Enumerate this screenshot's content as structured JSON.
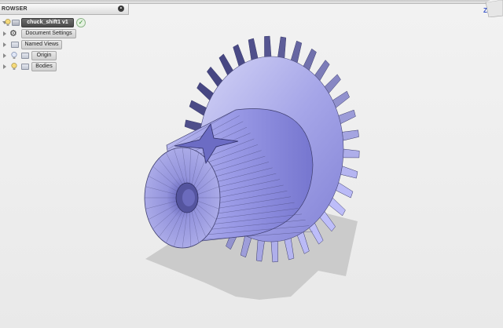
{
  "browser": {
    "header": "ROWSER",
    "collapse_icon": "minus-circle-icon",
    "items": [
      {
        "label": "chuck_shift1 v1",
        "icon": "lightbulb-icon",
        "status_icon": "check-icon",
        "style": "dark"
      },
      {
        "label": "Document Settings",
        "icon": "gear-icon"
      },
      {
        "label": "Named Views",
        "icon": "folder-icon"
      },
      {
        "label": "Origin",
        "icon": "lightbulb-icon"
      },
      {
        "label": "Bodies",
        "icon": "lightbulb-icon"
      }
    ]
  },
  "viewport": {
    "axis_label": "Z",
    "model_color": "#8f8fe0",
    "shadow_color": "#cfcfcf"
  }
}
